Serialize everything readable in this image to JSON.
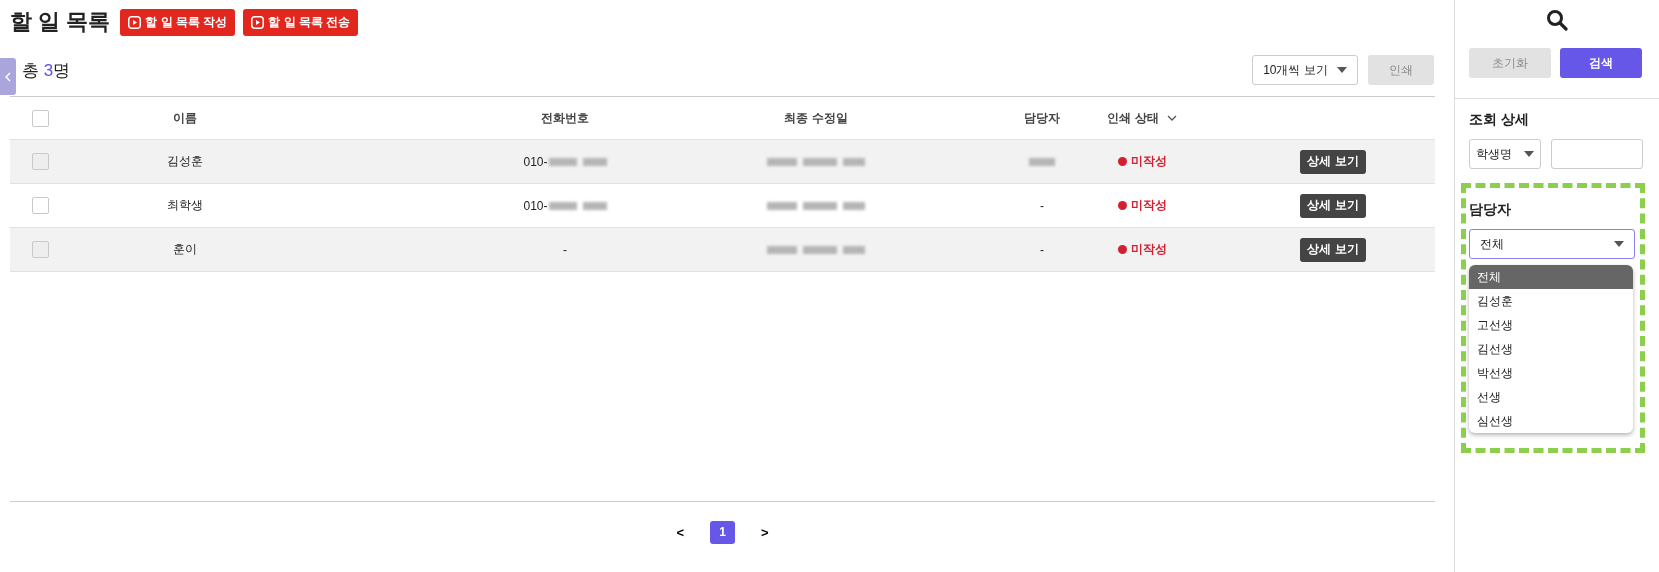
{
  "page_title": "할 일 목록",
  "header_buttons": [
    {
      "label": "할 일 목록 작성"
    },
    {
      "label": "할 일 목록 전송"
    }
  ],
  "total_label": "총",
  "total_count": "3",
  "total_unit": "명",
  "page_size_select": {
    "value": "10개씩 보기"
  },
  "print_button": {
    "label": "인쇄",
    "disabled": true
  },
  "table": {
    "header_checkbox_checked": false,
    "columns": [
      {
        "label": "이름",
        "sortable": false
      },
      {
        "label": "전화번호",
        "sortable": false
      },
      {
        "label": "최종 수정일",
        "sortable": false
      },
      {
        "label": "담당자",
        "sortable": false
      },
      {
        "label": "인쇄 상태",
        "sortable": true
      }
    ],
    "rows": [
      {
        "checked": false,
        "name": "김성훈",
        "phone": {
          "text": "010-",
          "redacted": true
        },
        "modified": {
          "redacted": true
        },
        "manager": {
          "redacted": true
        },
        "status": "미작성",
        "action": "상세 보기"
      },
      {
        "checked": false,
        "name": "최학생",
        "phone": {
          "text": "010-",
          "redacted": true
        },
        "modified": {
          "redacted": true
        },
        "manager": {
          "text": "-",
          "redacted": false
        },
        "status": "미작성",
        "action": "상세 보기"
      },
      {
        "checked": false,
        "name": "훈이",
        "phone": {
          "text": "-",
          "redacted": false
        },
        "modified": {
          "redacted": true
        },
        "manager": {
          "text": "-",
          "redacted": false
        },
        "status": "미작성",
        "action": "상세 보기"
      }
    ]
  },
  "pagination": {
    "prev": "<",
    "pages": [
      {
        "label": "1",
        "selected": true
      }
    ],
    "next": ">"
  },
  "side_panel": {
    "reset_button": {
      "label": "초기화",
      "disabled": true
    },
    "search_button": {
      "label": "검색"
    },
    "detail_title": "조회 상세",
    "field_select": {
      "value": "학생명"
    },
    "manager_filter": {
      "title": "담당자",
      "highlighted": true,
      "value": "전체",
      "expanded": true,
      "options": [
        {
          "label": "전체",
          "selected": true
        },
        {
          "label": "김성훈",
          "selected": false
        },
        {
          "label": "고선생",
          "selected": false
        },
        {
          "label": "김선생",
          "selected": false
        },
        {
          "label": "박선생",
          "selected": false
        },
        {
          "label": "선생",
          "selected": false
        },
        {
          "label": "심선생",
          "selected": false
        }
      ]
    }
  }
}
